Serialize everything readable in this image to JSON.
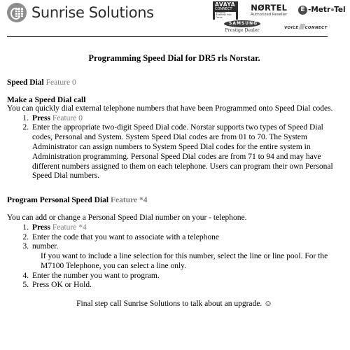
{
  "header": {
    "brand_name": "Sunrise Solutions",
    "brand_icon": "phone-keypad-icon",
    "partners": [
      {
        "name": "avaya",
        "word": "AVAYA",
        "sub": "CONNECT",
        "sub2": "Bringing Business Into Focus"
      },
      {
        "name": "nortel",
        "word": "NØRTEL",
        "sub": "Authorized Reseller"
      },
      {
        "name": "e-metrotel",
        "badge": "E",
        "word": "-Metr",
        "word2": "Tel"
      },
      {
        "name": "samsung",
        "word": "SAMSUNG",
        "sub": "Prestige Dealer"
      },
      {
        "name": "voice-connect",
        "word": "VOICE",
        "word2": "CONNECT"
      }
    ]
  },
  "document": {
    "title": "Programming Speed Dial for DR5 rls Norstar.",
    "speed_dial_label": "Speed Dial",
    "speed_dial_feature": "Feature 0",
    "section1": {
      "heading": "Make a Speed Dial call",
      "intro": "You can quickly dial external telephone numbers that have been Programmed onto Speed Dial codes.",
      "steps": [
        {
          "lead": "Press",
          "feature": "Feature 0"
        },
        {
          "text": "Enter the appropriate two-digit Speed Dial code. Norstar supports two types of Speed Dial codes, Personal and System. System Speed Dial codes are from 01 to 70. The System Administrator can assign numbers to System Speed Dial codes for the entire system in Administration programming. Personal Speed Dial codes are from 71 to 94 and may have different numbers assigned to them on each telephone. Users can program their own Personal Speed Dial numbers."
        }
      ]
    },
    "section2": {
      "heading": "Program Personal Speed Dial",
      "heading_feature": "Feature *4",
      "intro": "You can add or change a Personal Speed Dial number on your - telephone.",
      "steps": [
        {
          "lead": "Press",
          "feature": "Feature *4"
        },
        {
          "text": "Enter the code that you want to associate with a telephone"
        },
        {
          "text": "number.",
          "sub": "If you want to include a line selection for this number, select the line or line pool. For the M7100 Telephone, you can select a line only."
        },
        {
          "text": "Enter the number you want to program."
        },
        {
          "text": "Press OK or Hold."
        }
      ]
    },
    "closing": "Final step call Sunrise Solutions to talk about an upgrade.",
    "closing_smiley": "☺"
  }
}
